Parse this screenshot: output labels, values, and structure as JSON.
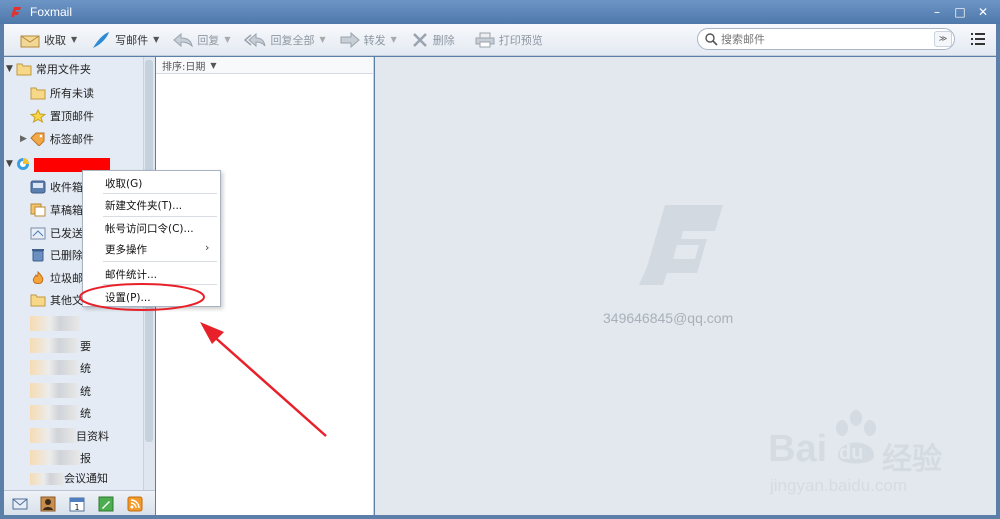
{
  "window": {
    "title": "Foxmail",
    "minimize": "–",
    "maximize": "□",
    "close": "✕"
  },
  "toolbar": {
    "receive": "收取",
    "compose": "写邮件",
    "reply": "回复",
    "reply_all": "回复全部",
    "forward": "转发",
    "delete": "删除",
    "print_preview": "打印预览",
    "search_placeholder": "搜索邮件"
  },
  "sidebar": {
    "common_folder": "常用文件夹",
    "all_unread": "所有未读",
    "pinned": "置顶邮件",
    "tagged": "标签邮件",
    "inbox": "收件箱",
    "drafts": "草稿箱",
    "sent": "已发送",
    "deleted": "已删除",
    "junk": "垃圾邮",
    "other": "其他文",
    "blurred_items": [
      "",
      "要",
      "统",
      "统",
      "统",
      "目资料",
      "报",
      "会议通知"
    ]
  },
  "maillist": {
    "sort_label": "排序:日期"
  },
  "preview": {
    "account_email": "349646845@qq.com"
  },
  "context_menu": {
    "items": [
      "收取(G)",
      "新建文件夹(T)...",
      "帐号访问口令(C)...",
      "更多操作",
      "邮件统计...",
      "设置(P)..."
    ]
  },
  "watermark": {
    "brand": "Bai",
    "paw": "du",
    "cn": "经验",
    "url": "jingyan.baidu.com"
  },
  "colors": {
    "accent": "#4f78ab",
    "annotation": "#e8202a"
  }
}
